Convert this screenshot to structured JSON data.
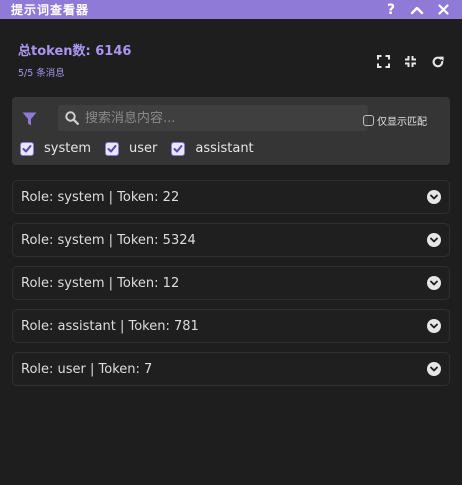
{
  "window": {
    "title": "提示词查看器"
  },
  "controls": {
    "help": "?"
  },
  "header": {
    "total_tokens_label": "总token数: 6146",
    "message_count": "5/5 条消息"
  },
  "tools": [
    "fullscreen-icon",
    "collapse-icon",
    "refresh-icon"
  ],
  "filter": {
    "search_placeholder": "搜索消息内容...",
    "search_value": "",
    "only_match_label": "仅显示匹配",
    "roles": [
      {
        "label": "system",
        "checked": true
      },
      {
        "label": "user",
        "checked": true
      },
      {
        "label": "assistant",
        "checked": true
      }
    ]
  },
  "messages": [
    {
      "summary": "Role: system | Token: 22"
    },
    {
      "summary": "Role: system | Token: 5324"
    },
    {
      "summary": "Role: system | Token: 12"
    },
    {
      "summary": "Role: assistant | Token: 781"
    },
    {
      "summary": "Role: user | Token: 7"
    }
  ],
  "colors": {
    "accent": "#8f7ad8",
    "accent_text": "#a896f0",
    "background": "#1e1e1e",
    "panel": "#353535"
  }
}
